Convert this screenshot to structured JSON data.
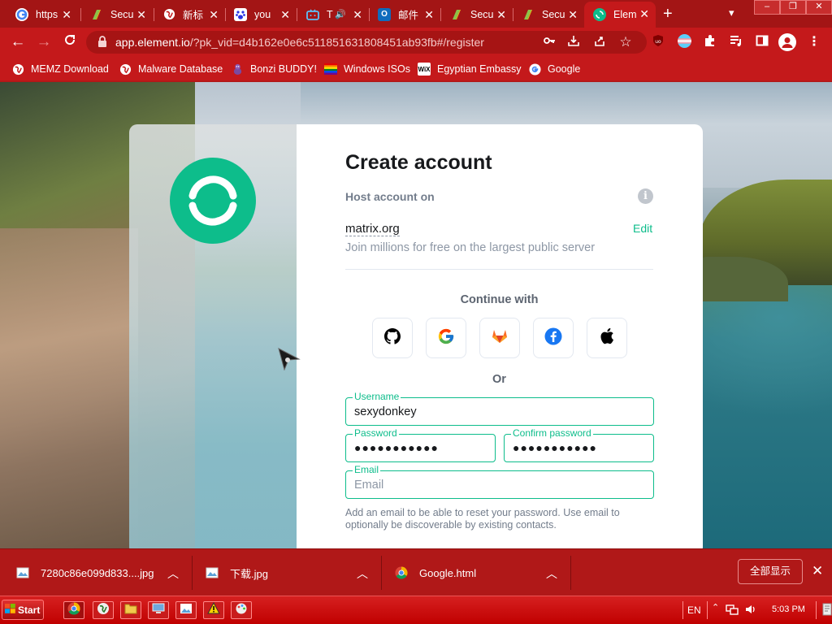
{
  "colors": {
    "chrome_red": "#c4191b",
    "element_green": "#0dbd8b",
    "taskbar_red": "#c00000"
  },
  "tabs": [
    {
      "title": "https",
      "icon": "google-icon",
      "active": false
    },
    {
      "title": "Secu",
      "icon": "security-site-icon",
      "active": false
    },
    {
      "title": "新标",
      "icon": "globe-icon",
      "active": false
    },
    {
      "title": "you",
      "icon": "baidu-paw-icon",
      "active": false
    },
    {
      "title": "T",
      "icon": "bilibili-tv-icon",
      "active": false,
      "audio": true
    },
    {
      "title": "邮件",
      "icon": "outlook-icon",
      "active": false
    },
    {
      "title": "Secu",
      "icon": "security-site-icon",
      "active": false
    },
    {
      "title": "Secu",
      "icon": "security-site-icon",
      "active": false
    },
    {
      "title": "Elem",
      "icon": "element-icon",
      "active": true
    }
  ],
  "omnibox": {
    "domain": "app.element.io",
    "path": "/?pk_vid=d4b162e0e6c511851631808451ab93fb#/register"
  },
  "bookmarks": [
    {
      "label": "MEMZ Download",
      "icon": "globe-icon"
    },
    {
      "label": "Malware Database",
      "icon": "globe-icon"
    },
    {
      "label": "Bonzi BUDDY!",
      "icon": "bonzi-icon"
    },
    {
      "label": "Windows ISOs",
      "icon": "windows-flag-icon"
    },
    {
      "label": "Egyptian Embassy",
      "icon": "wix-icon"
    },
    {
      "label": "Google",
      "icon": "google-icon"
    }
  ],
  "register": {
    "title": "Create account",
    "host_label": "Host account on",
    "server": "matrix.org",
    "edit_label": "Edit",
    "server_desc": "Join millions for free on the largest public server",
    "continue_with": "Continue with",
    "sso_providers": [
      "github-icon",
      "google-icon",
      "gitlab-icon",
      "facebook-icon",
      "apple-icon"
    ],
    "or_label": "Or",
    "username_label": "Username",
    "username_value": "sexydonkey",
    "password_label": "Password",
    "password_value": "●●●●●●●●●●●",
    "confirm_label": "Confirm password",
    "confirm_value": "●●●●●●●●●●●",
    "email_label": "Email",
    "email_placeholder": "Email",
    "email_help": "Add an email to be able to reset your password. Use email to optionally be discoverable by existing contacts."
  },
  "downloads": {
    "items": [
      {
        "name": "7280c86e099d833....jpg",
        "icon": "image-file-icon"
      },
      {
        "name": "下载.jpg",
        "icon": "image-file-icon"
      },
      {
        "name": "Google.html",
        "icon": "chrome-icon"
      }
    ],
    "show_all": "全部显示"
  },
  "taskbar": {
    "start_label": "Start",
    "lang": "EN",
    "time": "5:03 PM"
  }
}
